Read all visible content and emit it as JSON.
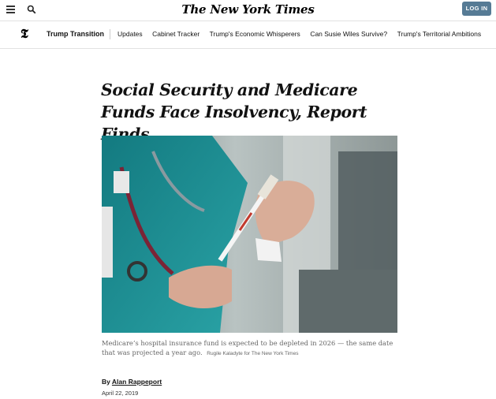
{
  "masthead": {
    "logo": "The New York Times",
    "login_label": "LOG IN"
  },
  "nav": {
    "section": "Trump Transition",
    "items": [
      "Updates",
      "Cabinet Tracker",
      "Trump's Economic Whisperers",
      "Can Susie Wiles Survive?",
      "Trump's Territorial Ambitions"
    ]
  },
  "article": {
    "headline": "Social Security and Medicare Funds Face Insolvency, Report Finds",
    "caption": "Medicare’s hospital insurance fund is expected to be depleted in 2026 — the same date that was projected a year ago.",
    "photo_credit": "Rugile Kaladyte for The New York Times",
    "byline_prefix": "By",
    "author": "Alan Rappeport",
    "date": "April 22, 2019"
  },
  "colors": {
    "login_button": "#567b95",
    "scrubs": "#1f8f92"
  }
}
